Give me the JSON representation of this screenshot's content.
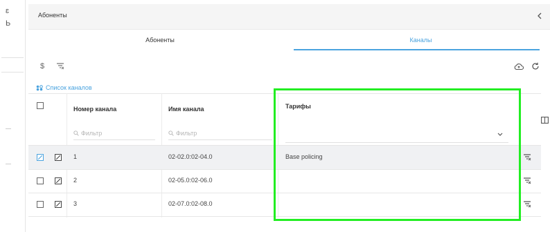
{
  "sidebar": {
    "frag1": "ɛ",
    "frag2": "Ь"
  },
  "panel": {
    "title": "Абоненты",
    "collapse_icon": "chevron-left-icon"
  },
  "tabs": [
    {
      "label": "Абоненты",
      "active": false
    },
    {
      "label": "Каналы",
      "active": true
    }
  ],
  "toolbar": {
    "left_icons": [
      "dollar-icon",
      "filter-clear-icon"
    ],
    "right_icons": [
      "cloud-upload-icon",
      "refresh-icon"
    ]
  },
  "section": {
    "title": "Список каналов",
    "icon": "channels-icon"
  },
  "table": {
    "columns": [
      "Номер канала",
      "Имя канала",
      "Тарифы"
    ],
    "filter_placeholder": "Фильтр",
    "rows": [
      {
        "number": "1",
        "name": "02-02.0:02-04.0",
        "tariff": "Base policing",
        "selected": true
      },
      {
        "number": "2",
        "name": "02-05.0:02-06.0",
        "tariff": "",
        "selected": false
      },
      {
        "number": "3",
        "name": "02-07.0:02-08.0",
        "tariff": "",
        "selected": false
      }
    ]
  },
  "colors": {
    "accent": "#4aa3df",
    "highlight": "#22ee22"
  }
}
